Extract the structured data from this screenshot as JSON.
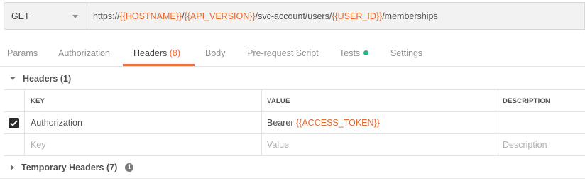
{
  "request": {
    "method": "GET",
    "url_segments": [
      {
        "text": "https://",
        "var": false
      },
      {
        "text": "{{HOSTNAME}}",
        "var": true
      },
      {
        "text": "/",
        "var": false
      },
      {
        "text": "{{API_VERSION}}",
        "var": true
      },
      {
        "text": "/svc-account/users/",
        "var": false
      },
      {
        "text": "{{USER_ID}}",
        "var": true
      },
      {
        "text": "/memberships",
        "var": false
      }
    ]
  },
  "tabs": {
    "params": "Params",
    "authorization": "Authorization",
    "headers": "Headers",
    "headers_count": "(8)",
    "body": "Body",
    "prerequest": "Pre-request Script",
    "tests": "Tests",
    "settings": "Settings"
  },
  "headers_section": {
    "title": "Headers",
    "count": "(1)"
  },
  "table": {
    "columns": {
      "key": "KEY",
      "value": "VALUE",
      "description": "DESCRIPTION"
    },
    "rows": [
      {
        "checked": true,
        "key": "Authorization",
        "value_prefix": "Bearer ",
        "value_var": "{{ACCESS_TOKEN}}",
        "description": ""
      }
    ],
    "placeholders": {
      "key": "Key",
      "value": "Value",
      "description": "Description"
    }
  },
  "temporary_headers": {
    "title": "Temporary Headers",
    "count": "(7)",
    "info_glyph": "i"
  },
  "colors": {
    "accent": "#f26b3a",
    "variable": "#e8692c",
    "tests_dot": "#26b47f"
  },
  "icons": {
    "method_dropdown": "chevron-down-icon",
    "section_collapse": "caret-down-icon",
    "section_expand": "caret-right-icon",
    "checkbox": "check-icon",
    "info": "info-icon"
  }
}
